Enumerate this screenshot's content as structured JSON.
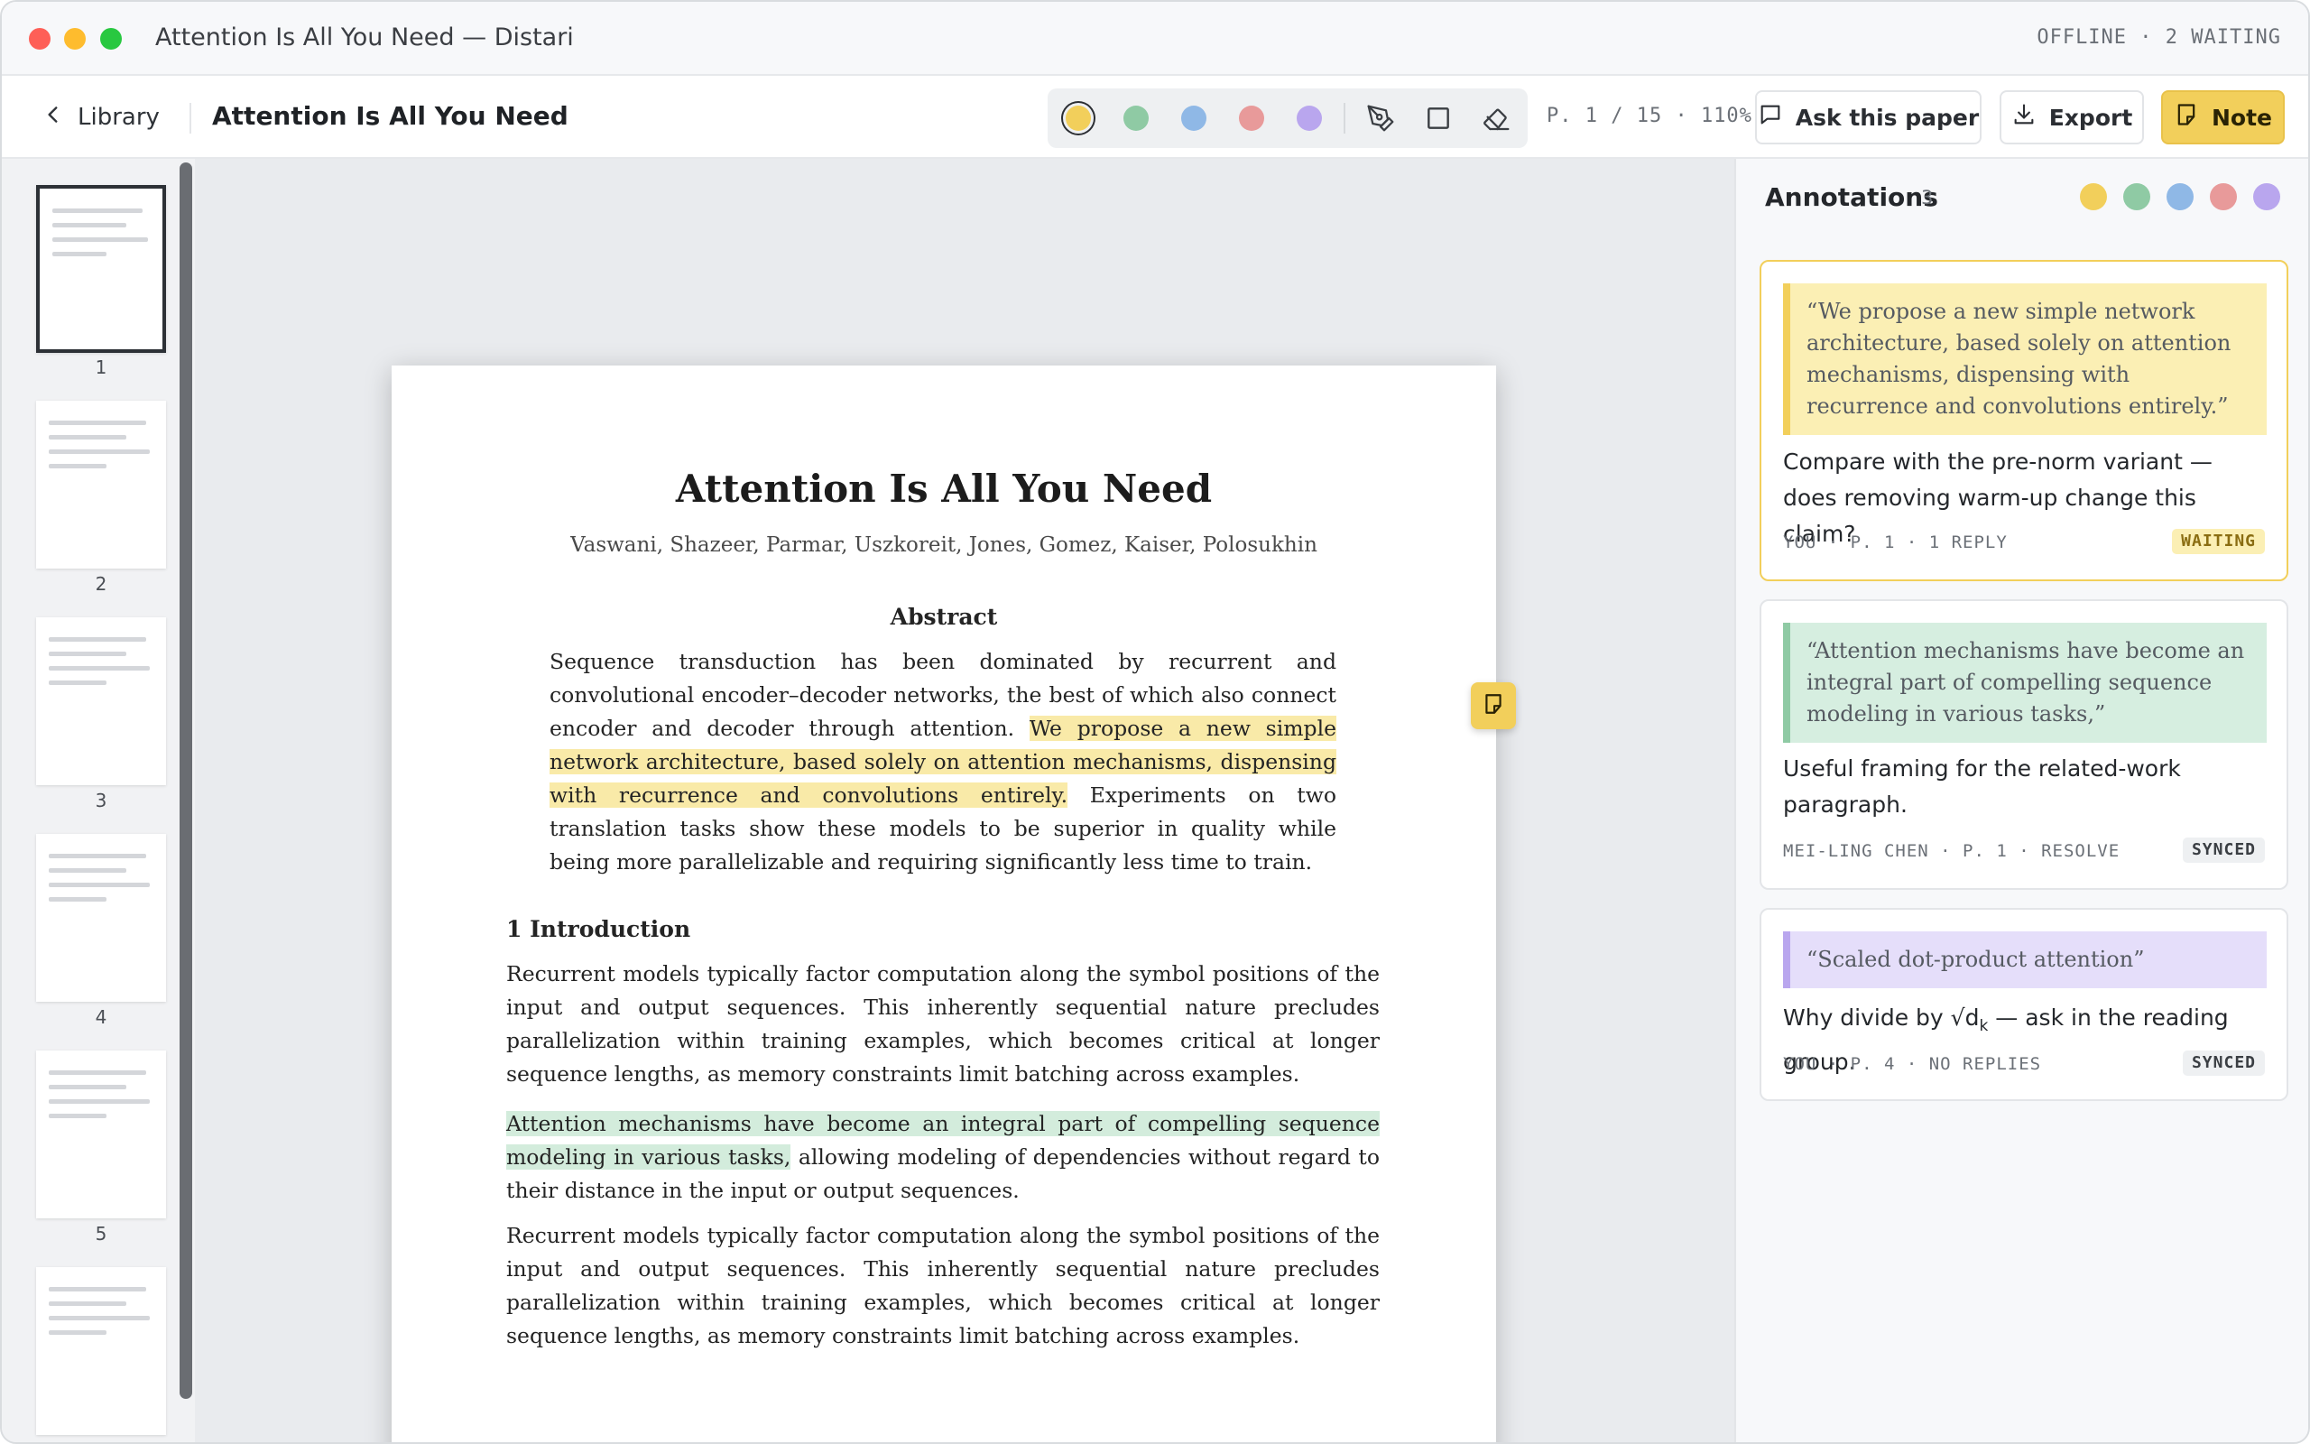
{
  "window": {
    "title": "Attention Is All You Need — Distari",
    "status": "OFFLINE · 2 WAITING"
  },
  "toolbar": {
    "back_label": "Library",
    "doc_title": "Attention Is All You Need",
    "highlight_colors": [
      "#f2cf5b",
      "#8fcaa4",
      "#8fb8e6",
      "#e89a9a",
      "#b9a6ee"
    ],
    "active_color": "yellow",
    "tools": [
      "pen-icon",
      "rectangle-icon",
      "eraser-icon"
    ],
    "page_info": "P. 1 / 15 · 110%",
    "ask_label": "Ask this paper",
    "export_label": "Export",
    "note_label": "Note"
  },
  "thumbnails": [
    "1",
    "2",
    "3",
    "4",
    "5",
    "6"
  ],
  "document": {
    "title": "Attention Is All You Need",
    "authors": "Vaswani, Shazeer, Parmar, Uszkoreit, Jones, Gomez, Kaiser, Polosukhin",
    "abstract_heading": "Abstract",
    "abstract_pre": "Sequence transduction has been dominated by recurrent and convolutional encoder–decoder networks, the best of which also connect encoder and decoder through attention. ",
    "abstract_highlight": "We propose a new simple network architecture, based solely on attention mechanisms, dispensing with recurrence and convolutions entirely.",
    "abstract_post": " Experiments on two translation tasks show these models to be superior in quality while being more parallelizable and requiring significantly less time to train.",
    "section_heading": "1  Introduction",
    "para1": "Recurrent models typically factor computation along the symbol positions of the input and output sequences. This inherently sequential nature precludes parallelization within training examples, which becomes critical at longer sequence lengths, as memory constraints limit batching across examples.",
    "para2_highlight": "Attention mechanisms have become an integral part of compelling sequence modeling in various tasks,",
    "para2_post": " allowing modeling of dependencies without regard to their distance in the input or output sequences.",
    "para3": "Recurrent models typically factor computation along the symbol positions of the input and output sequences. This inherently sequential nature precludes parallelization within training examples, which becomes critical at longer sequence lengths, as memory constraints limit batching across examples."
  },
  "annotations_panel": {
    "title": "Annotations",
    "count": "3",
    "filter_colors": [
      "#f2cf5b",
      "#8fcaa4",
      "#8fb8e6",
      "#e89a9a",
      "#b9a6ee"
    ],
    "cards": [
      {
        "quote": "“We propose a new simple network architecture, based solely on attention mechanisms, dispensing with recurrence and convolutions entirely.”",
        "note": "Compare with the pre-norm variant — does removing warm-up change this claim?",
        "meta": "YOU · P. 1 · 1 REPLY",
        "badge": "WAITING",
        "color": "yellow"
      },
      {
        "quote": "“Attention mechanisms have become an integral part of compelling sequence modeling in various tasks,”",
        "note": "Useful framing for the related-work paragraph.",
        "meta": "MEI-LING CHEN · P. 1 · RESOLVE",
        "badge": "SYNCED",
        "color": "green"
      },
      {
        "quote": "“Scaled dot-product attention”",
        "note_pre": "Why divide by ",
        "note_math": "√d",
        "note_sub": "k",
        "note_post": " — ask in the reading group.",
        "meta": "YOU · P. 4 · NO REPLIES",
        "badge": "SYNCED",
        "color": "purple"
      }
    ]
  }
}
